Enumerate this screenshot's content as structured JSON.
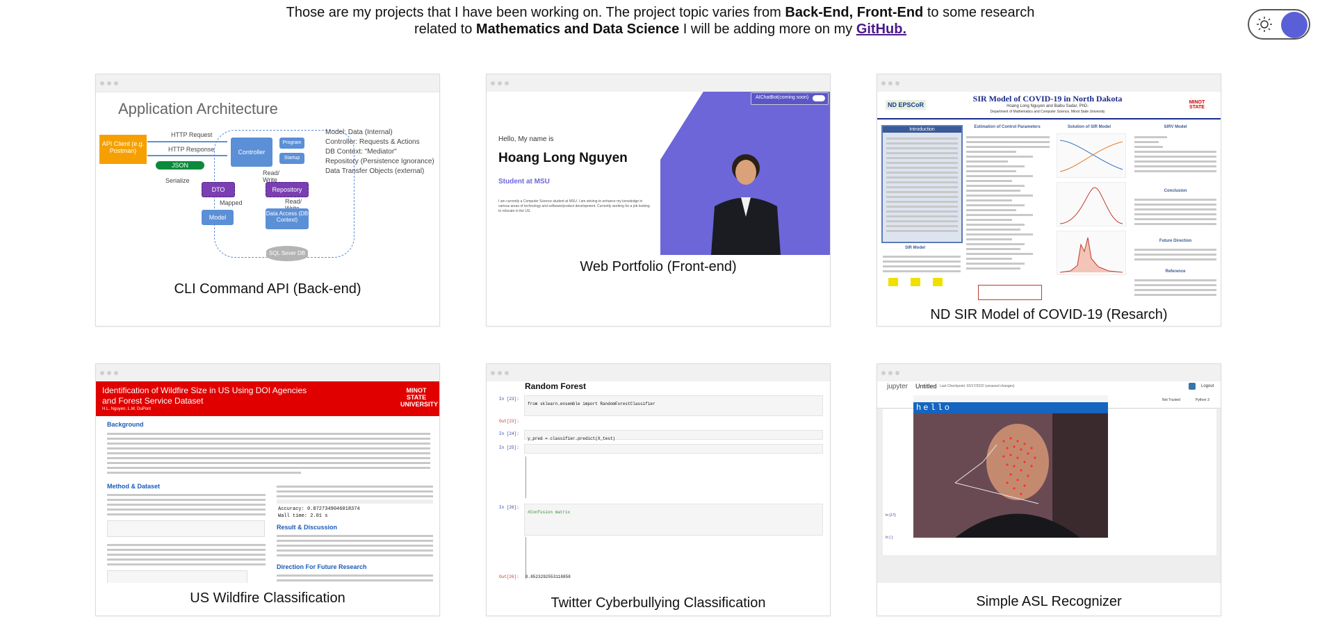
{
  "intro": {
    "t1": "Those are my projects that I have been working on. The project topic varies from ",
    "b1": "Back-End, Front-End",
    "t2": " to some research",
    "t3": "related to ",
    "b2": "Mathematics and Data Science",
    "t4": " I will be adding more on my ",
    "link": "GitHub."
  },
  "theme_toggle": {
    "icon": "sun-icon",
    "accent": "#5a5fd8"
  },
  "projects": [
    {
      "caption": "CLI Command API (Back-end)",
      "arch": {
        "title": "Application Architecture",
        "api_client": "API Client (e.g. Postman)",
        "http_request": "HTTP Request",
        "http_response": "HTTP Response",
        "json": "JSON",
        "serialize": "Serialize",
        "controller": "Controller",
        "program": "Program",
        "startup": "Startup",
        "read_write1": "Read/ Write",
        "dto": "DTO",
        "mapped": "Mapped",
        "repository": "Repository",
        "read_write2": "Read/ Write",
        "model": "Model",
        "data_access": "Data Access (DB Context)",
        "sql": "SQL Sever DB",
        "legend": [
          "Model: Data (Internal)",
          "Controller: Requests & Actions",
          "DB Context: \"Mediator\"",
          "Repository (Persistence Ignorance)",
          "Data Transfer Objects (external)"
        ]
      }
    },
    {
      "caption": "Web Portfolio (Front-end)",
      "portfolio": {
        "hello": "Hello, My name is",
        "name": "Hoang Long Nguyen",
        "role": "Student at MSU",
        "chatbot": "AIChatBot(coming soon)",
        "bio": "I am currently a Computer Science student at MSU. I am striving to enhance my knowledge in various areas of technology and software/product development. Currently working for a job looking to relocate in the US."
      }
    },
    {
      "caption": "ND SIR Model of COVID-19 (Resarch)",
      "poster": {
        "title": "SIR Model of COVID-19 in North Dakota",
        "authors": "Hoang Long Nguyen and Baibu Sadar, PhD.",
        "dept": "Department of Mathematics and Computer Science, Minot State University",
        "logo_left": "ND EPSCoR",
        "logo_right": "MINOT STATE",
        "sections": [
          "Introduction",
          "Estimation of Control Parameters",
          "Solution of SIR Model",
          "SIRV Model",
          "Conclusion",
          "Future Direction",
          "Reference",
          "SIR Model"
        ]
      }
    },
    {
      "caption": "US Wildfire Classification",
      "wildfire": {
        "title1": "Identification of Wildfire Size in US Using DOI Agencies",
        "title2": "and Forest Service Dataset",
        "authors": "H.L. Nguyen, L.M. DuPont",
        "logo": "MINOT STATE UNIVERSITY",
        "background": "Background",
        "method": "Method & Dataset",
        "result": "Result & Discussion",
        "future": "Direction For Future Research",
        "accuracy": "Accuracy:  0.8727349046018374",
        "walltime": "Wall time: 2.01 s"
      }
    },
    {
      "caption": "Twitter Cyberbullying Classification",
      "notebook": {
        "heading": "Random Forest",
        "in1": "In [23]:",
        "out1": "Out[23]:",
        "in2": "In [24]:",
        "in3": "In [25]:",
        "in4": "In [26]:",
        "out4": "Out[26]:",
        "code1": "from sklearn.ensemble import RandomForestClassifier",
        "code2": "y_pred = classifier.predict(X_test)",
        "code3": "#Confusion matrix",
        "result": "0.8523292553118858"
      }
    },
    {
      "caption": "Simple ASL Recognizer",
      "jupyter": {
        "logo": "jupyter",
        "notebook": "Untitled",
        "checkpoint": "Last Checkpoint: 03/17/2022  (unsaved changes)",
        "trusted": "Not Trusted",
        "kernel": "Python 3",
        "logout": "Logout",
        "window": "hello",
        "in_label": "In [17]:",
        "in_label2": "In [ ]:"
      }
    }
  ]
}
